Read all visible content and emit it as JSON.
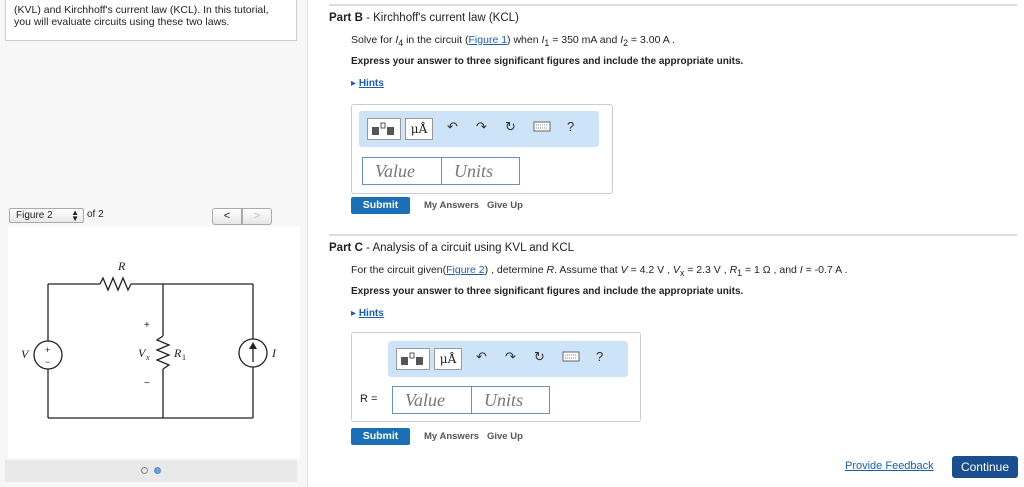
{
  "intro": {
    "line1": "(KVL) and Kirchhoff's current law (KCL). In this tutorial,",
    "line2": "you will evaluate circuits using these two laws."
  },
  "figure_nav": {
    "selected": "Figure 2",
    "of_label": "of 2",
    "prev_glyph": "<",
    "next_glyph": ">"
  },
  "figure": {
    "label_R": "R",
    "label_R1": "R",
    "label_R1_sub": "1",
    "label_Vx": "V",
    "label_Vx_sub": "x",
    "label_V": "V",
    "label_I": "I",
    "plus": "+",
    "minus": "−"
  },
  "partB": {
    "title_bold": "Part B",
    "title_rest": " - Kirchhoff's current law (KCL)",
    "q_pre": "Solve for ",
    "q_var": "I",
    "q_var_sub": "4",
    "q_mid": " in the circuit (",
    "q_link": "Figure 1",
    "q_post": ") when ",
    "q_i1": "I",
    "q_i1_sub": "1",
    "q_i1_val": " = 350 mA and ",
    "q_i2": "I",
    "q_i2_sub": "2",
    "q_i2_val": " = 3.00 A .",
    "instruction": "Express your answer to three significant figures and include the appropriate units.",
    "hints": "Hints",
    "value_placeholder": "Value",
    "units_placeholder": "Units",
    "submit": "Submit",
    "my_answers": "My Answers",
    "give_up": "Give Up"
  },
  "partC": {
    "title_bold": "Part C",
    "title_rest": " - Analysis of a circuit using KVL and KCL",
    "q_pre": "For the circuit given(",
    "q_link": "Figure 2",
    "q_post": ") , determine ",
    "q_R": "R",
    "q_assume": ". Assume that ",
    "q_V": "V",
    "q_V_val": " = 4.2 V , ",
    "q_Vx": "V",
    "q_Vx_sub": "x",
    "q_Vx_val": " = 2.3 V , ",
    "q_R1": "R",
    "q_R1_sub": "1",
    "q_R1_val": " = 1 Ω , and ",
    "q_I": "I",
    "q_I_val": " = -0.7 A .",
    "instruction": "Express your answer to three significant figures and include the appropriate units.",
    "hints": "Hints",
    "r_label": "R =",
    "value_placeholder": "Value",
    "units_placeholder": "Units",
    "submit": "Submit",
    "my_answers": "My Answers",
    "give_up": "Give Up"
  },
  "toolbar": {
    "mu_label": "μÅ",
    "undo": "↶",
    "redo": "↷",
    "reset": "↻",
    "help": "?"
  },
  "footer": {
    "feedback": "Provide Feedback",
    "continue": "Continue"
  }
}
